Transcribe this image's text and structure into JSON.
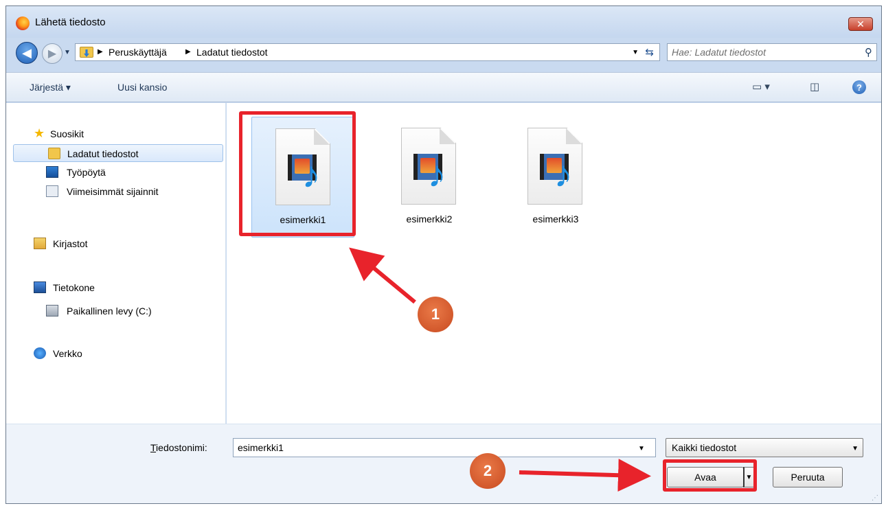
{
  "window": {
    "title": "Lähetä tiedosto",
    "close_glyph": "✕"
  },
  "nav": {
    "breadcrumb": [
      "Peruskäyttäjä",
      "Ladatut tiedostot"
    ],
    "search_placeholder": "Hae: Ladatut tiedostot"
  },
  "toolbar": {
    "organize_label": "Järjestä ▾",
    "new_folder_label": "Uusi kansio"
  },
  "sidebar": {
    "items": [
      {
        "label": "Suosikit",
        "icon": "star-icon"
      },
      {
        "label": "Ladatut tiedostot",
        "icon": "downloads-folder-icon",
        "selected": true
      },
      {
        "label": "Työpöytä",
        "icon": "desktop-icon"
      },
      {
        "label": "Viimeisimmät sijainnit",
        "icon": "recent-places-icon"
      },
      {
        "label": "Kirjastot",
        "icon": "libraries-icon"
      },
      {
        "label": "Tietokone",
        "icon": "computer-icon"
      },
      {
        "label": "Paikallinen levy (C:)",
        "icon": "local-disk-icon"
      },
      {
        "label": "Verkko",
        "icon": "network-icon"
      }
    ]
  },
  "files": [
    {
      "name": "esimerkki1",
      "icon": "media-file-icon",
      "selected": true
    },
    {
      "name": "esimerkki2",
      "icon": "media-file-icon"
    },
    {
      "name": "esimerkki3",
      "icon": "media-file-icon"
    }
  ],
  "annotations": {
    "badge1": "1",
    "badge2": "2",
    "highlight_color": "#e8232b",
    "badge_color": "#d4582a"
  },
  "bottom": {
    "filename_label_prefix": "T",
    "filename_label_rest": "iedostonimi:",
    "filename_value": "esimerkki1",
    "filetype_value": "Kaikki tiedostot",
    "open_label": "Avaa",
    "cancel_label": "Peruuta"
  }
}
